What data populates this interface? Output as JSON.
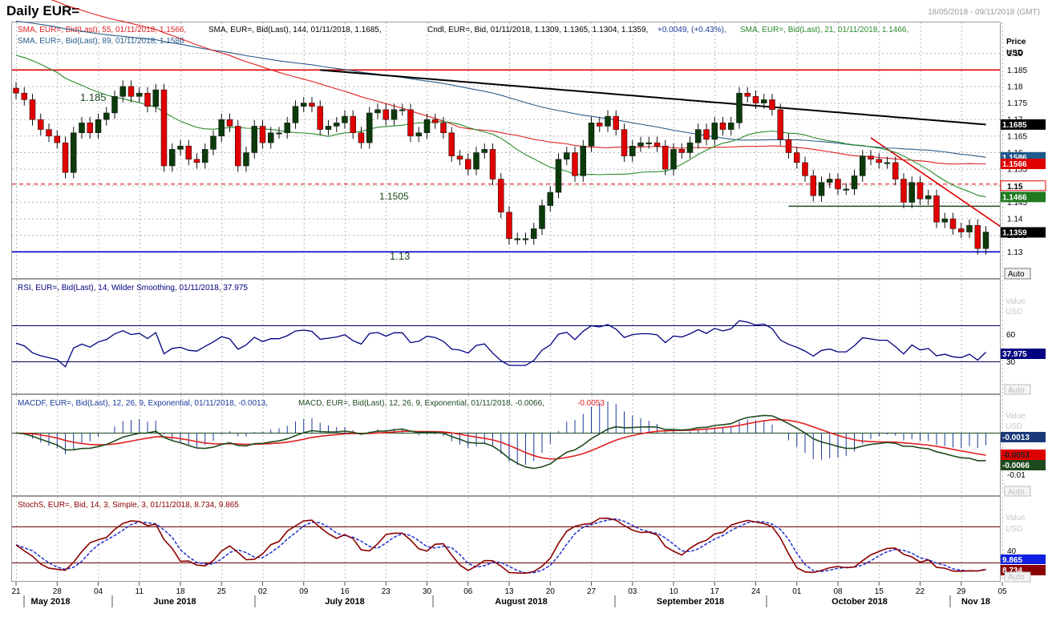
{
  "window": {
    "title": "Daily EUR=",
    "date_range": "18/05/2018 - 09/11/2018 (GMT)"
  },
  "colors": {
    "up_candle": "#0b3b0b",
    "down_candle": "#e00000",
    "sma144": "#000000",
    "sma55": "#e02020",
    "sma21": "#2a8a2a",
    "sma89": "#2a5d8a",
    "rsi": "#000080",
    "macdf": "#1a3a9a",
    "macd": "#1f4a1f",
    "signal": "#e02020",
    "stoch_k": "#8b0000",
    "stoch_d": "#2030d0",
    "support": "#0000cc",
    "resistance": "#e00000",
    "grid": "#b8b8b8"
  },
  "price_panel": {
    "legend_line1": {
      "sma55": "SMA, EUR=, Bid(Last),  55, 01/11/2018, 1.1566,",
      "sma144": "SMA, EUR=, Bid(Last),  144, 01/11/2018, 1.1685,",
      "candle": "Cndl, EUR=, Bid,  01/11/2018, 1.1309, 1.1365, 1.1304, 1.1359,",
      "change": "+0.0049,  (+0.43%),",
      "sma21": "SMA, EUR=, Bid(Last),  21, 01/11/2018, 1.1466,"
    },
    "legend_line2": "SMA, EUR=, Bid(Last),  89, 01/11/2018, 1.1586",
    "axis_title": [
      "Price",
      "USD"
    ],
    "auto_label": "Auto",
    "ticks": [
      "1.19",
      "1.185",
      "1.18",
      "1.175",
      "1.17",
      "1.165",
      "1.16",
      "1.155",
      "1.15",
      "1.145",
      "1.14",
      "1.135",
      "1.13"
    ],
    "level_labels": {
      "high": "1.185",
      "mid": "1.1505",
      "low": "1.13"
    },
    "value_tags": [
      {
        "text": "1.1685",
        "bg": "#000000",
        "fg": "#ffffff",
        "y": 1.1685
      },
      {
        "text": "1.1586",
        "bg": "#1f5a8c",
        "fg": "#ffffff",
        "y": 1.1586
      },
      {
        "text": "1.1566",
        "bg": "#e00000",
        "fg": "#ffffff",
        "y": 1.1566
      },
      {
        "text": "1.1466",
        "bg": "#1f7a1f",
        "fg": "#ffffff",
        "y": 1.1466
      },
      {
        "text": "1.1359",
        "bg": "#000000",
        "fg": "#ffffff",
        "y": 1.1359
      }
    ]
  },
  "rsi_panel": {
    "legend": "RSI, EUR=, Bid(Last),  14, Wilder Smoothing, 01/11/2018, 37.975",
    "axis_title": [
      "Value",
      "USD"
    ],
    "ticks": [
      "60",
      "30"
    ],
    "value_tag": "37.975",
    "auto_label": "Auto"
  },
  "macd_panel": {
    "legend_macdf": "MACDF, EUR=, Bid(Last),  12, 26, 9, Exponential, 01/11/2018, -0.0013,",
    "legend_macd": "MACD, EUR=, Bid(Last),  12, 26, 9, Exponential, 01/11/2018, -0.0066,",
    "legend_signal": "-0.0053",
    "axis_title": [
      "Value",
      "USD"
    ],
    "ticks": [
      "-0.01"
    ],
    "tags": [
      "-0.0013",
      "-0.0053",
      "-0.0066"
    ],
    "auto_label": "Auto"
  },
  "stoch_panel": {
    "legend": "StochS, EUR=, Bid,  14, 3, Simple, 3, 01/11/2018, 8.734, 9.865",
    "axis_title": [
      "Value",
      "USD"
    ],
    "ticks": [
      "40"
    ],
    "tags": [
      "9.865",
      "8.734"
    ],
    "auto_label": "Auto"
  },
  "x_axis": {
    "day_ticks": [
      "21",
      "28",
      "04",
      "11",
      "18",
      "25",
      "02",
      "09",
      "16",
      "23",
      "30",
      "06",
      "13",
      "20",
      "27",
      "03",
      "10",
      "17",
      "24",
      "01",
      "08",
      "15",
      "22",
      "29",
      "05"
    ],
    "month_labels": [
      "May 2018",
      "June 2018",
      "July 2018",
      "August 2018",
      "September 2018",
      "October 2018",
      "Nov 18"
    ]
  },
  "chart_data": {
    "type": "candlestick",
    "title": "Daily EUR=",
    "ylabel": "Price USD",
    "ylim": [
      1.125,
      1.195
    ],
    "horizontal_levels": [
      1.185,
      1.1505,
      1.13,
      1.1438
    ],
    "x": [
      "2018-05-21",
      "2018-05-22",
      "2018-05-23",
      "2018-05-24",
      "2018-05-25",
      "2018-05-28",
      "2018-05-29",
      "2018-05-30",
      "2018-05-31",
      "2018-06-01",
      "2018-06-04",
      "2018-06-05",
      "2018-06-06",
      "2018-06-07",
      "2018-06-08",
      "2018-06-11",
      "2018-06-12",
      "2018-06-13",
      "2018-06-14",
      "2018-06-15",
      "2018-06-18",
      "2018-06-19",
      "2018-06-20",
      "2018-06-21",
      "2018-06-22",
      "2018-06-25",
      "2018-06-26",
      "2018-06-27",
      "2018-06-28",
      "2018-06-29",
      "2018-07-02",
      "2018-07-03",
      "2018-07-04",
      "2018-07-05",
      "2018-07-06",
      "2018-07-09",
      "2018-07-10",
      "2018-07-11",
      "2018-07-12",
      "2018-07-13",
      "2018-07-16",
      "2018-07-17",
      "2018-07-18",
      "2018-07-19",
      "2018-07-20",
      "2018-07-23",
      "2018-07-24",
      "2018-07-25",
      "2018-07-26",
      "2018-07-27",
      "2018-07-30",
      "2018-07-31",
      "2018-08-01",
      "2018-08-02",
      "2018-08-03",
      "2018-08-06",
      "2018-08-07",
      "2018-08-08",
      "2018-08-09",
      "2018-08-10",
      "2018-08-13",
      "2018-08-14",
      "2018-08-15",
      "2018-08-16",
      "2018-08-17",
      "2018-08-20",
      "2018-08-21",
      "2018-08-22",
      "2018-08-23",
      "2018-08-24",
      "2018-08-27",
      "2018-08-28",
      "2018-08-29",
      "2018-08-30",
      "2018-08-31",
      "2018-09-03",
      "2018-09-04",
      "2018-09-05",
      "2018-09-06",
      "2018-09-07",
      "2018-09-10",
      "2018-09-11",
      "2018-09-12",
      "2018-09-13",
      "2018-09-14",
      "2018-09-17",
      "2018-09-18",
      "2018-09-19",
      "2018-09-20",
      "2018-09-21",
      "2018-09-24",
      "2018-09-25",
      "2018-09-26",
      "2018-09-27",
      "2018-09-28",
      "2018-10-01",
      "2018-10-02",
      "2018-10-03",
      "2018-10-04",
      "2018-10-05",
      "2018-10-08",
      "2018-10-09",
      "2018-10-10",
      "2018-10-11",
      "2018-10-12",
      "2018-10-15",
      "2018-10-16",
      "2018-10-17",
      "2018-10-18",
      "2018-10-19",
      "2018-10-22",
      "2018-10-23",
      "2018-10-24",
      "2018-10-25",
      "2018-10-26",
      "2018-10-29",
      "2018-10-30",
      "2018-10-31",
      "2018-11-01"
    ],
    "close": [
      1.178,
      1.176,
      1.17,
      1.167,
      1.165,
      1.163,
      1.154,
      1.166,
      1.169,
      1.166,
      1.17,
      1.172,
      1.177,
      1.18,
      1.177,
      1.178,
      1.174,
      1.179,
      1.156,
      1.161,
      1.162,
      1.158,
      1.157,
      1.161,
      1.165,
      1.17,
      1.168,
      1.156,
      1.16,
      1.168,
      1.163,
      1.166,
      1.166,
      1.169,
      1.174,
      1.175,
      1.174,
      1.167,
      1.168,
      1.169,
      1.171,
      1.166,
      1.163,
      1.172,
      1.173,
      1.17,
      1.173,
      1.173,
      1.165,
      1.166,
      1.17,
      1.169,
      1.166,
      1.159,
      1.158,
      1.155,
      1.16,
      1.161,
      1.152,
      1.142,
      1.134,
      1.134,
      1.134,
      1.137,
      1.144,
      1.148,
      1.158,
      1.16,
      1.153,
      1.162,
      1.169,
      1.168,
      1.171,
      1.167,
      1.159,
      1.162,
      1.163,
      1.163,
      1.162,
      1.155,
      1.161,
      1.16,
      1.163,
      1.167,
      1.164,
      1.169,
      1.167,
      1.169,
      1.178,
      1.177,
      1.175,
      1.176,
      1.173,
      1.164,
      1.16,
      1.157,
      1.153,
      1.147,
      1.151,
      1.152,
      1.149,
      1.149,
      1.153,
      1.159,
      1.158,
      1.157,
      1.157,
      1.152,
      1.145,
      1.151,
      1.146,
      1.147,
      1.139,
      1.14,
      1.137,
      1.136,
      1.138,
      1.131,
      1.136
    ],
    "rsi": {
      "value": 37.975,
      "levels": [
        60,
        30
      ]
    },
    "macd": {
      "macd": -0.0066,
      "signal": -0.0053,
      "histogram": -0.0013
    },
    "stochastic": {
      "k": 8.734,
      "d": 9.865,
      "levels": [
        40
      ]
    }
  }
}
